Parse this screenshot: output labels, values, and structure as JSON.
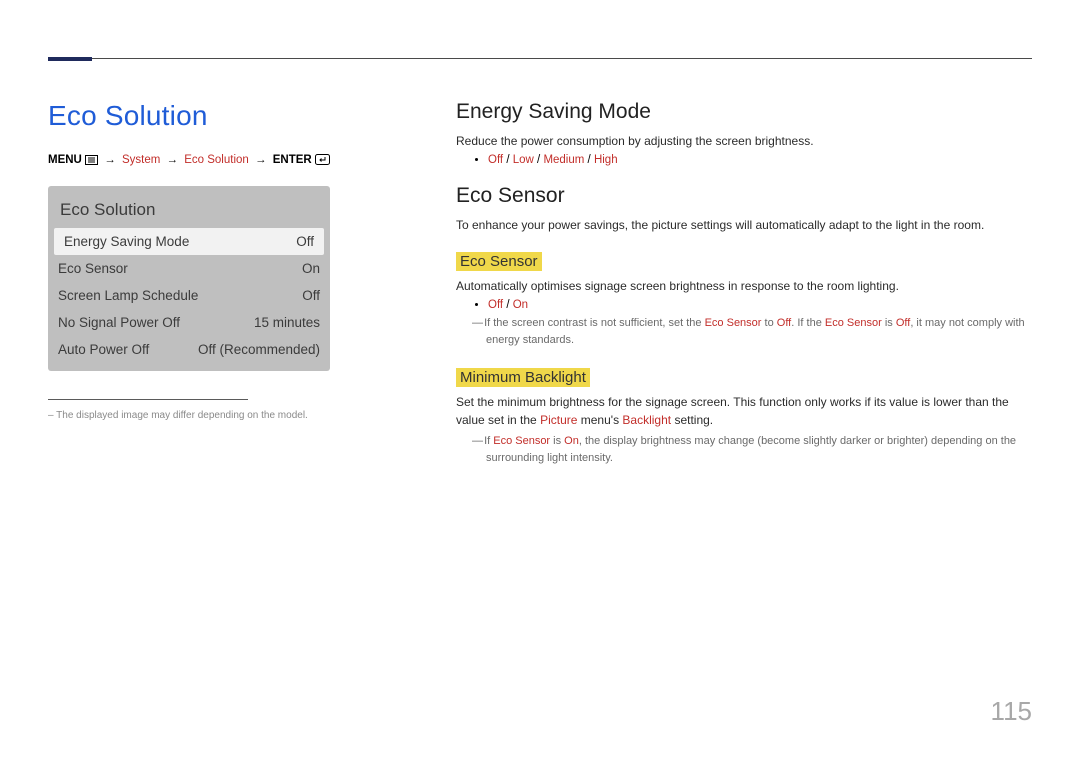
{
  "page_number": "115",
  "left": {
    "title": "Eco Solution",
    "breadcrumb": {
      "menu": "MENU",
      "system": "System",
      "eco": "Eco Solution",
      "enter": "ENTER"
    },
    "osd": {
      "title": "Eco Solution",
      "rows": [
        {
          "label": "Energy Saving Mode",
          "value": "Off",
          "selected": true
        },
        {
          "label": "Eco Sensor",
          "value": "On",
          "selected": false
        },
        {
          "label": "Screen Lamp Schedule",
          "value": "Off",
          "selected": false
        },
        {
          "label": "No Signal Power Off",
          "value": "15 minutes",
          "selected": false
        },
        {
          "label": "Auto Power Off",
          "value": "Off (Recommended)",
          "selected": false
        }
      ]
    },
    "image_note": "The displayed image may differ depending on the model."
  },
  "right": {
    "energy": {
      "heading": "Energy Saving Mode",
      "desc": "Reduce the power consumption by adjusting the screen brightness.",
      "options": [
        "Off",
        "Low",
        "Medium",
        "High"
      ]
    },
    "eco_sensor_section": {
      "heading": "Eco Sensor",
      "desc": "To enhance your power savings, the picture settings will automatically adapt to the light in the room."
    },
    "eco_sensor_sub": {
      "label": "Eco Sensor",
      "desc": "Automatically optimises signage screen brightness in response to the room lighting.",
      "options": [
        "Off",
        "On"
      ],
      "note_parts": {
        "p1": "If the screen contrast is not sufficient, set the ",
        "r1": "Eco Sensor",
        "p2": " to ",
        "r2": "Off",
        "p3": ". If the ",
        "r3": "Eco Sensor",
        "p4": " is ",
        "r4": "Off",
        "p5": ", it may not comply with energy standards."
      }
    },
    "min_backlight": {
      "label": "Minimum Backlight",
      "desc_parts": {
        "p1": "Set the minimum brightness for the signage screen. This function only works if its value is lower than the value set in the ",
        "r1": "Picture",
        "p2": " menu's ",
        "r2": "Backlight",
        "p3": " setting."
      },
      "note_parts": {
        "p1": "If ",
        "r1": "Eco Sensor",
        "p2": " is ",
        "r2": "On",
        "p3": ", the display brightness may change (become slightly darker or brighter) depending on the surrounding light intensity."
      }
    }
  }
}
